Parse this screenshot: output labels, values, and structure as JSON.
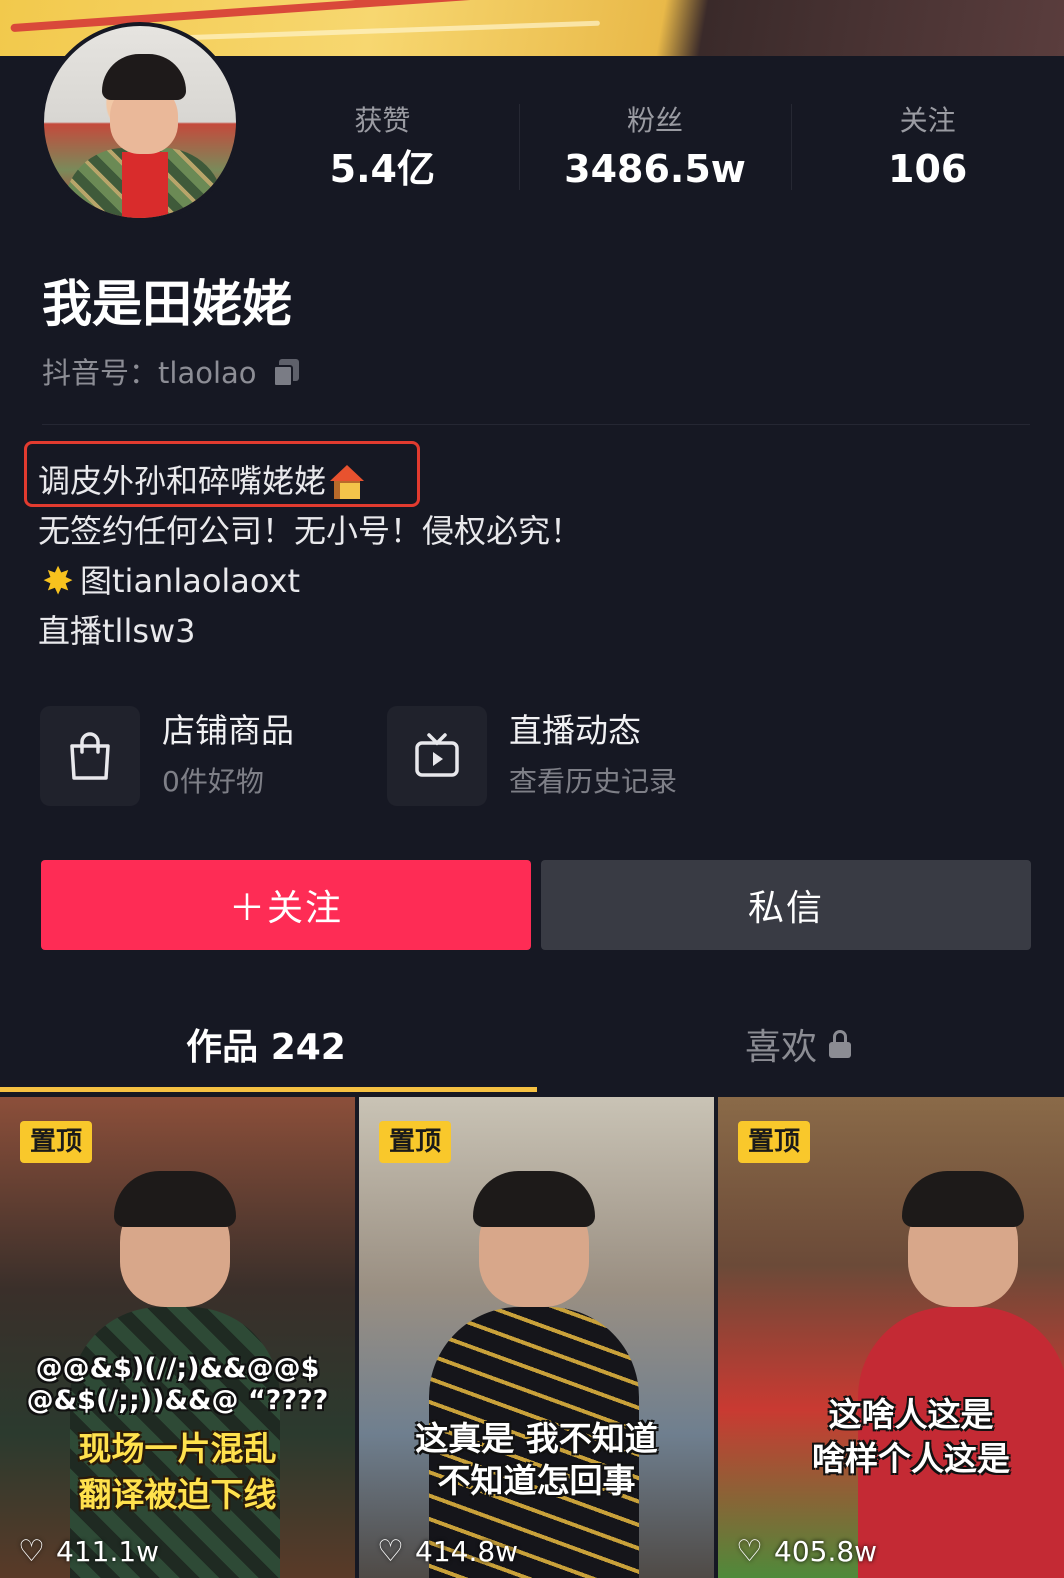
{
  "profile": {
    "name": "我是田姥姥",
    "uid_label": "抖音号：",
    "uid": "tlaolao"
  },
  "stats": [
    {
      "label": "获赞",
      "value": "5.4亿"
    },
    {
      "label": "粉丝",
      "value": "3486.5w"
    },
    {
      "label": "关注",
      "value": "106"
    }
  ],
  "bio": {
    "line1": "调皮外孙和碎嘴姥姥",
    "line2": "无签约任何公司！无小号！侵权必究！",
    "line3": "图tianlaolaoxt",
    "line4": "直播tllsw3"
  },
  "cards": {
    "shop": {
      "title": "店铺商品",
      "subtitle": "0件好物"
    },
    "live": {
      "title": "直播动态",
      "subtitle": "查看历史记录"
    }
  },
  "buttons": {
    "follow": "＋关注",
    "message": "私信"
  },
  "tabs": {
    "works": "作品 242",
    "likes": "喜欢"
  },
  "videos": [
    {
      "pin": "置顶",
      "caption_top": "@@&$)(//;)&&@@$",
      "caption_top2": "@&$(/;;))&&@ “????",
      "caption1": "现场一片混乱",
      "caption2": "翻译被迫下线",
      "likes": "411.1w"
    },
    {
      "pin": "置顶",
      "caption1": "这真是 我不知道",
      "caption2": "不知道怎回事",
      "likes": "414.8w"
    },
    {
      "pin": "置顶",
      "caption1": "这啥人这是",
      "caption2": "啥样个人这是",
      "likes": "405.8w"
    }
  ],
  "colors": {
    "background": "#161823",
    "follow_button": "#fe2c55",
    "message_button": "#393b44",
    "tab_indicator": "#f6c142",
    "highlight_box": "#e23b2f"
  }
}
